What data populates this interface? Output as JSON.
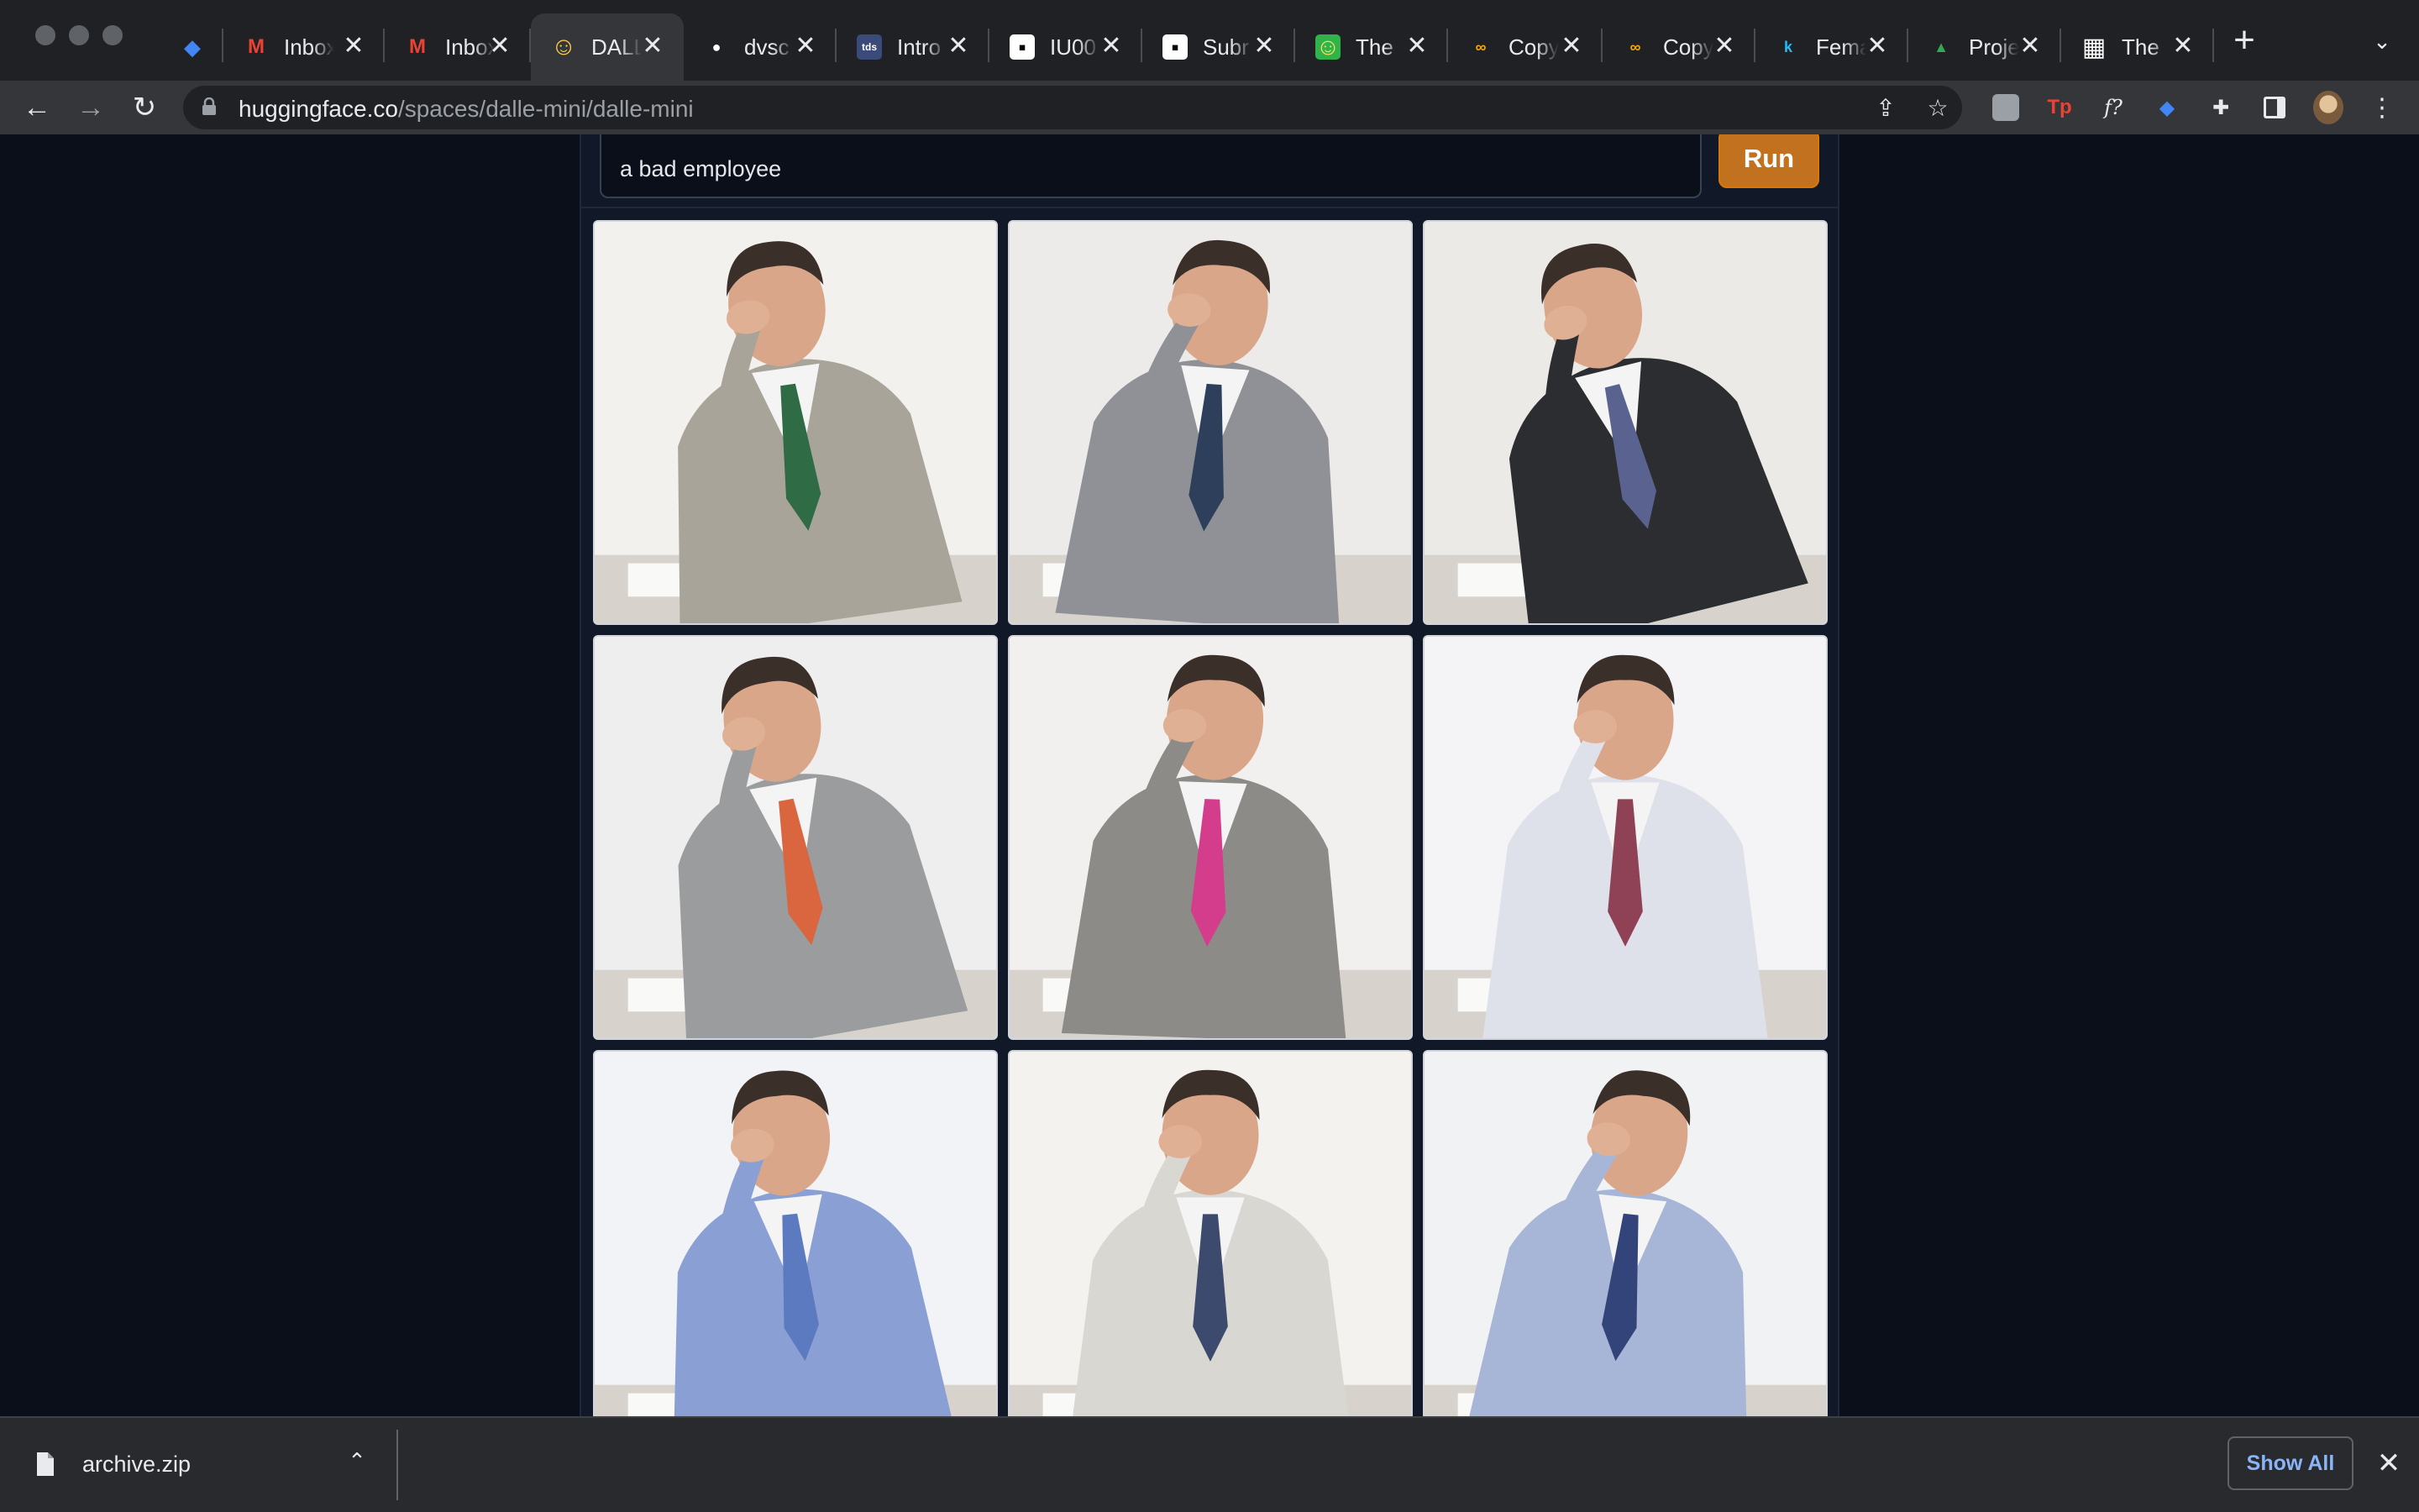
{
  "tabs": [
    {
      "title": "",
      "icon": "diamond-icon",
      "color": "#4285f4"
    },
    {
      "title": "Inbox",
      "icon": "gmail-icon",
      "color": "#ea4335"
    },
    {
      "title": "Inbox",
      "icon": "gmail-icon",
      "color": "#ea4335"
    },
    {
      "title": "DALL",
      "icon": "hugging-face-icon",
      "color": "#ffcc4d",
      "active": true
    },
    {
      "title": "dvsc",
      "icon": "github-icon",
      "color": "#ffffff"
    },
    {
      "title": "Intro",
      "icon": "tds-icon",
      "color": "#3a4b7a"
    },
    {
      "title": "IU00",
      "icon": "medium-icon",
      "color": "#000000"
    },
    {
      "title": "Subr",
      "icon": "medium-icon",
      "color": "#000000"
    },
    {
      "title": "The",
      "icon": "smiley-icon",
      "color": "#2fb34a"
    },
    {
      "title": "Copy",
      "icon": "colab-icon",
      "color": "#f9ab00"
    },
    {
      "title": "Copy",
      "icon": "colab-icon",
      "color": "#f9ab00"
    },
    {
      "title": "Fema",
      "icon": "kaggle-icon",
      "color": "#20beff"
    },
    {
      "title": "Proje",
      "icon": "drive-icon",
      "color": "#34a853"
    },
    {
      "title": "The",
      "icon": "qr-icon",
      "color": "#ffffff"
    }
  ],
  "address_bar": {
    "host": "huggingface.co",
    "path": "/spaces/dalle-mini/dalle-mini"
  },
  "app": {
    "prompt_value": "a bad employee",
    "run_label": "Run",
    "images": [
      {
        "subject": "man-grey-suit-green-tie",
        "tie": "#2f6b44",
        "jacket": "#a9a49a",
        "bg": "#f2f1ee"
      },
      {
        "subject": "man-grey-suit-at-desk",
        "tie": "#2e3f5c",
        "jacket": "#8f9196",
        "bg": "#ecebe9"
      },
      {
        "subject": "man-dark-suit-striped-tie",
        "tie": "#5a6390",
        "jacket": "#2c2d31",
        "bg": "#ebeae6"
      },
      {
        "subject": "man-grey-shirt-orange-tie",
        "tie": "#d9663f",
        "jacket": "#9a9c9e",
        "bg": "#eeeeee"
      },
      {
        "subject": "man-grey-suit-pink-tie",
        "tie": "#d43d8c",
        "jacket": "#8c8b88",
        "bg": "#f1f0ee"
      },
      {
        "subject": "man-white-shirt-red-tie",
        "tie": "#8f4256",
        "jacket": "#dfe1ea",
        "bg": "#f4f4f6"
      },
      {
        "subject": "man-blue-shirt-striped-tie",
        "tie": "#5b7ac0",
        "jacket": "#8aa0d4",
        "bg": "#f2f3f6"
      },
      {
        "subject": "man-white-shirt-navy-tie",
        "tie": "#3c4a6e",
        "jacket": "#d9d7d2",
        "bg": "#f3f2ef"
      },
      {
        "subject": "man-blue-shirt-laptop",
        "tie": "#33447a",
        "jacket": "#a7b6d6",
        "bg": "#f1f2f4"
      }
    ]
  },
  "downloads": {
    "file_name": "archive.zip",
    "show_all_label": "Show All"
  }
}
